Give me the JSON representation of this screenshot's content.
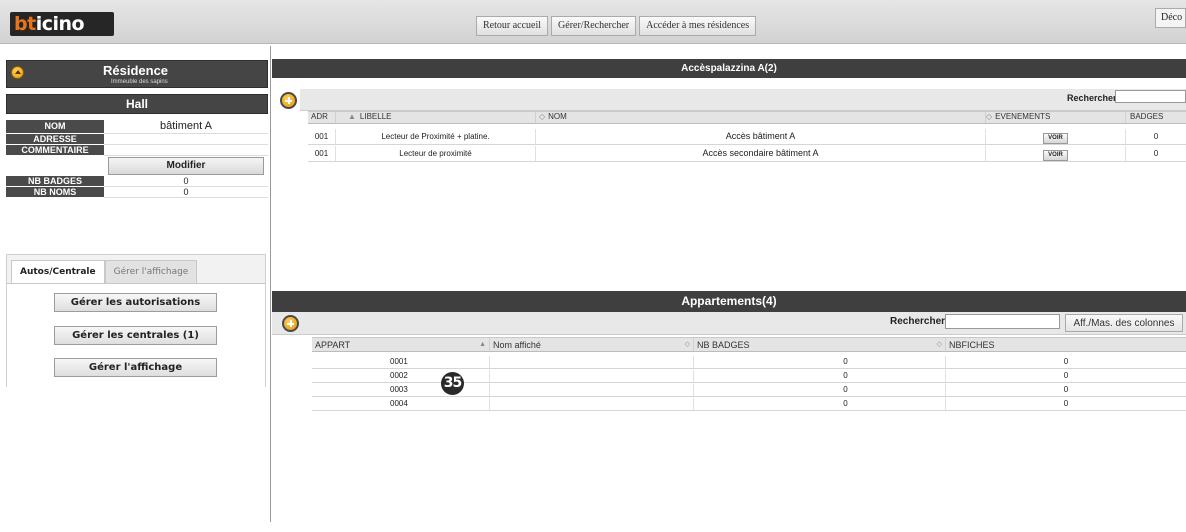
{
  "header": {
    "logo": {
      "part1": "bt",
      "part2": "icino"
    },
    "nav": [
      "Retour accueil",
      "Gérer/Rechercher",
      "Accéder à mes résidences"
    ],
    "deconnexion": "Déco"
  },
  "residence": {
    "title": "Résidence",
    "subtitle": "Immeuble des sapins",
    "section": "Hall"
  },
  "props": {
    "nom": {
      "label": "NOM",
      "value": "bâtiment A"
    },
    "adresse": {
      "label": "ADRESSE",
      "value": ""
    },
    "commentaire": {
      "label": "COMMENTAIRE",
      "value": ""
    },
    "modifier": "Modifier",
    "nb_badges": {
      "label": "NB BADGES",
      "value": "0"
    },
    "nb_noms": {
      "label": "NB NOMS",
      "value": "0"
    }
  },
  "tabs": {
    "active": "Autos/Centrale",
    "inactive": "Gérer l'affichage"
  },
  "actions": [
    "Gérer les autorisations",
    "Gérer les centrales (1)",
    "Gérer l'affichage"
  ],
  "acces": {
    "title": "Accèspalazzina A(2)",
    "search_label": "Rechercher",
    "columns": [
      "ADR",
      "LIBELLE",
      "NOM",
      "EVENEMENTS",
      "BADGES"
    ],
    "rows": [
      {
        "adr": "001",
        "libelle": "Lecteur de Proximité + platine.",
        "nom": "Accès bâtiment A",
        "evenements": "VOIR",
        "badges": "0"
      },
      {
        "adr": "001",
        "libelle": "Lecteur de proximité",
        "nom": "Accès secondaire bâtiment A",
        "evenements": "VOIR",
        "badges": "0"
      }
    ]
  },
  "appartements": {
    "title": "Appartements(4)",
    "search_label": "Rechercher",
    "aff_mas": "Aff./Mas. des colonnes",
    "columns": [
      "APPART",
      "Nom affiché",
      "NB BADGES",
      "NBFICHES"
    ],
    "rows": [
      {
        "appart": "0001",
        "nom": "",
        "badges": "0",
        "fiches": "0"
      },
      {
        "appart": "0002",
        "nom": "",
        "badges": "0",
        "fiches": "0"
      },
      {
        "appart": "0003",
        "nom": "",
        "badges": "0",
        "fiches": "0"
      },
      {
        "appart": "0004",
        "nom": "",
        "badges": "0",
        "fiches": "0"
      }
    ]
  },
  "marker": "35"
}
